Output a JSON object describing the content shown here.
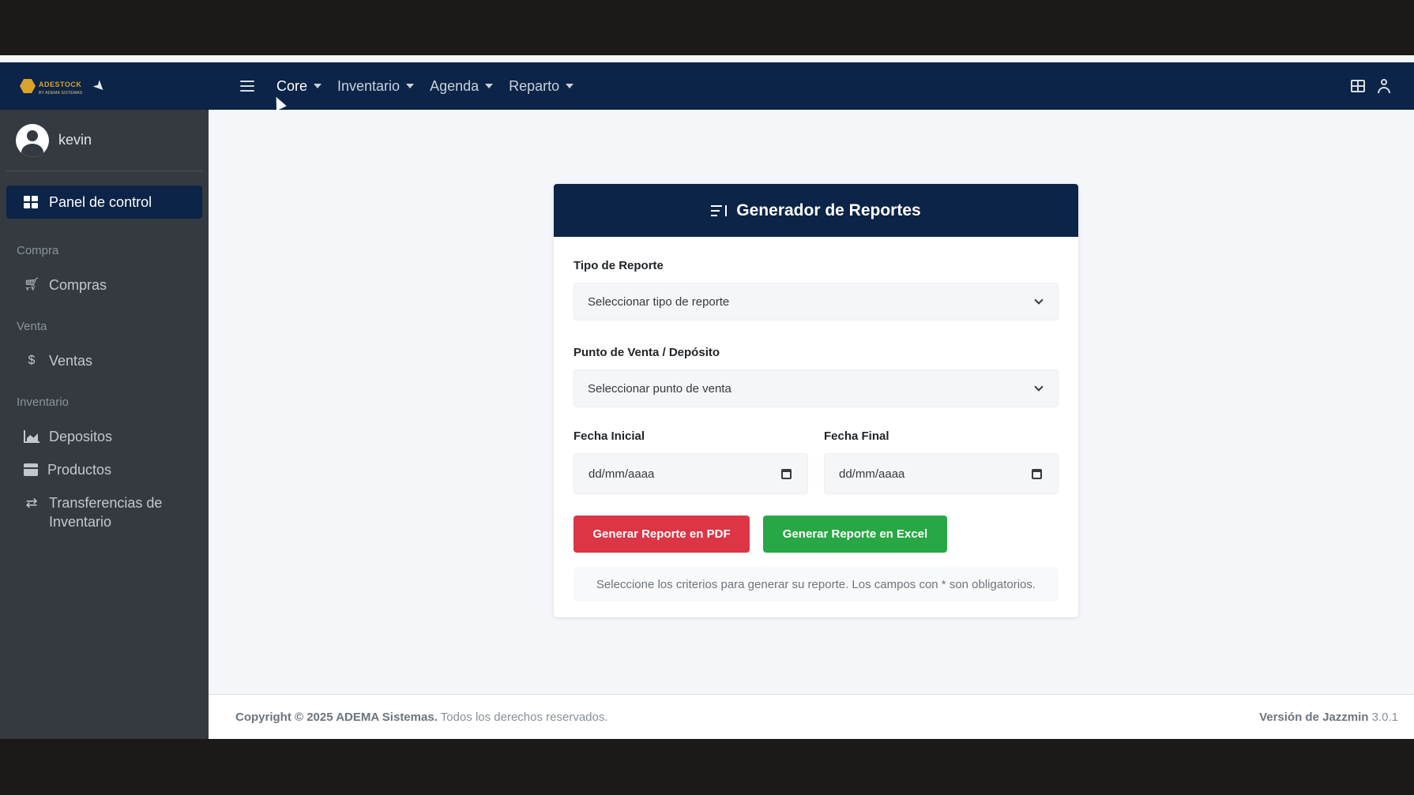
{
  "navbar": {
    "brand": {
      "logo_text": "ADESTOCK",
      "logo_sub": "BY ADEMA SISTEMAS"
    },
    "menu": [
      {
        "label": "Core"
      },
      {
        "label": "Inventario"
      },
      {
        "label": "Agenda"
      },
      {
        "label": "Reparto"
      }
    ]
  },
  "sidebar": {
    "username": "kevin",
    "active_item": "Panel de control",
    "sections": [
      {
        "header": "Compra",
        "items": [
          "Compras"
        ]
      },
      {
        "header": "Venta",
        "items": [
          "Ventas"
        ]
      },
      {
        "header": "Inventario",
        "items": [
          "Depositos",
          "Productos",
          "Transferencias de Inventario"
        ]
      }
    ]
  },
  "report": {
    "title": "Generador de Reportes",
    "tipo_label": "Tipo de Reporte",
    "tipo_placeholder": "Seleccionar tipo de reporte",
    "punto_label": "Punto de Venta / Depósito",
    "punto_placeholder": "Seleccionar punto de venta",
    "fecha_inicial_label": "Fecha Inicial",
    "fecha_inicial_value": "dd/mm/aaaa",
    "fecha_final_label": "Fecha Final",
    "fecha_final_value": "dd/mm/aaaa",
    "pdf_button": "Generar Reporte en PDF",
    "excel_button": "Generar Reporte en Excel",
    "help_text": "Seleccione los criterios para generar su reporte. Los campos con * son obligatorios."
  },
  "footer": {
    "copyright_bold": "Copyright © 2025 ADEMA Sistemas.",
    "copyright_rest": "Todos los derechos reservados.",
    "version_bold": "Versión de Jazzmin",
    "version_num": "3.0.1"
  },
  "colors": {
    "navbar": "#0b2447",
    "sidebar": "#343a40",
    "pdf_button": "#dc3545",
    "excel_button": "#28a745"
  }
}
